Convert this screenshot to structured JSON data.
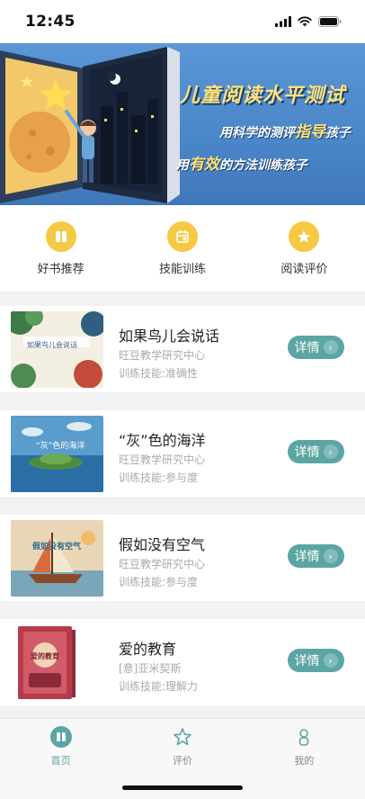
{
  "status_bar": {
    "time": "12:45"
  },
  "banner": {
    "title": "儿童阅读水平测试",
    "subtitle1_pre": "用科学的测评",
    "subtitle1_hl": "指导",
    "subtitle1_post": "孩子",
    "subtitle2_pre": "用",
    "subtitle2_hl": "有效",
    "subtitle2_post": "的方法训练孩子"
  },
  "categories": [
    {
      "label": "好书推荐",
      "icon": "book-icon"
    },
    {
      "label": "技能训练",
      "icon": "calendar-icon"
    },
    {
      "label": "阅读评价",
      "icon": "star-icon"
    }
  ],
  "books": [
    {
      "title": "如果鸟儿会说话",
      "author": "旺豆教学研究中心",
      "skill": "训练技能:准确性",
      "button": "详情",
      "cover_text": "如果鸟儿会说话"
    },
    {
      "title": "“灰”色的海洋",
      "author": "旺豆教学研究中心",
      "skill": "训练技能:参与度",
      "button": "详情",
      "cover_text": "“灰”色的海洋"
    },
    {
      "title": "假如没有空气",
      "author": "旺豆教学研究中心",
      "skill": "训练技能:参与度",
      "button": "详情",
      "cover_text": "假如没有空气"
    },
    {
      "title": "爱的教育",
      "author": "[意]亚米契斯",
      "skill": "训练技能:理解力",
      "button": "详情",
      "cover_text": "爱的教育"
    }
  ],
  "tabs": [
    {
      "label": "首页",
      "icon": "home-icon",
      "active": true
    },
    {
      "label": "评价",
      "icon": "star-outline-icon",
      "active": false
    },
    {
      "label": "我的",
      "icon": "person-icon",
      "active": false
    }
  ],
  "colors": {
    "accent": "#5ba6a2",
    "category_icon": "#f6c944",
    "banner_blue": "#4a86c8",
    "banner_highlight": "#ffe27a"
  }
}
